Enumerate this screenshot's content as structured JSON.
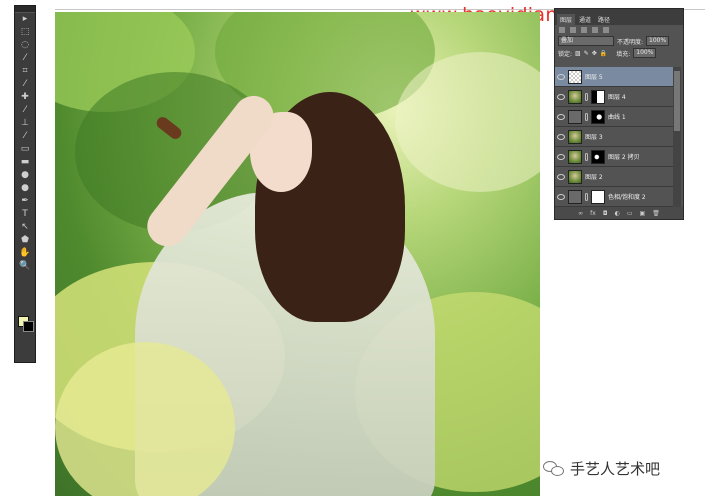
{
  "watermark": "www.haoyidian.com",
  "toolbar": {
    "tools": [
      "move-tool",
      "marquee-tool",
      "lasso-tool",
      "quick-select-tool",
      "crop-tool",
      "eyedropper-tool",
      "healing-brush-tool",
      "brush-tool",
      "clone-stamp-tool",
      "history-brush-tool",
      "eraser-tool",
      "gradient-tool",
      "blur-tool",
      "dodge-tool",
      "pen-tool",
      "type-tool",
      "path-select-tool",
      "shape-tool",
      "hand-tool",
      "zoom-tool"
    ],
    "glyphs": [
      "▸",
      "⬚",
      "◌",
      "⁄",
      "⌗",
      "⁄",
      "✚",
      "⁄",
      "⊥",
      "⁄",
      "▭",
      "▬",
      "●",
      "●",
      "✒",
      "T",
      "↖",
      "⬟",
      "✋",
      "🔍"
    ],
    "foreground_color": "#f0f4b0",
    "background_color": "#000000"
  },
  "layers_panel": {
    "blend_mode": "叠加",
    "opacity_label": "不透明度:",
    "opacity_value": "100%",
    "lock_label": "锁定:",
    "fill_label": "填充:",
    "fill_value": "100%",
    "layers": [
      {
        "name": "图层 5",
        "thumb": "trans",
        "mask": "",
        "selected": true
      },
      {
        "name": "图层 4",
        "thumb": "photo-t",
        "mask": "mask1",
        "selected": false
      },
      {
        "name": "曲线 1",
        "thumb": "adj",
        "mask": "mask2",
        "selected": false
      },
      {
        "name": "图层 3",
        "thumb": "photo-t",
        "mask": "",
        "selected": false
      },
      {
        "name": "图层 2 拷贝",
        "thumb": "photo-t",
        "mask": "mask3",
        "selected": false
      },
      {
        "name": "图层 2",
        "thumb": "photo-t",
        "mask": "",
        "selected": false
      },
      {
        "name": "色相/饱和度 2",
        "thumb": "adj",
        "mask": "white",
        "selected": false
      }
    ],
    "bottom_icons": [
      "∞",
      "fx",
      "◘",
      "◐",
      "▭",
      "▣",
      "🗑"
    ]
  },
  "badge": {
    "text": "手艺人艺术吧"
  }
}
